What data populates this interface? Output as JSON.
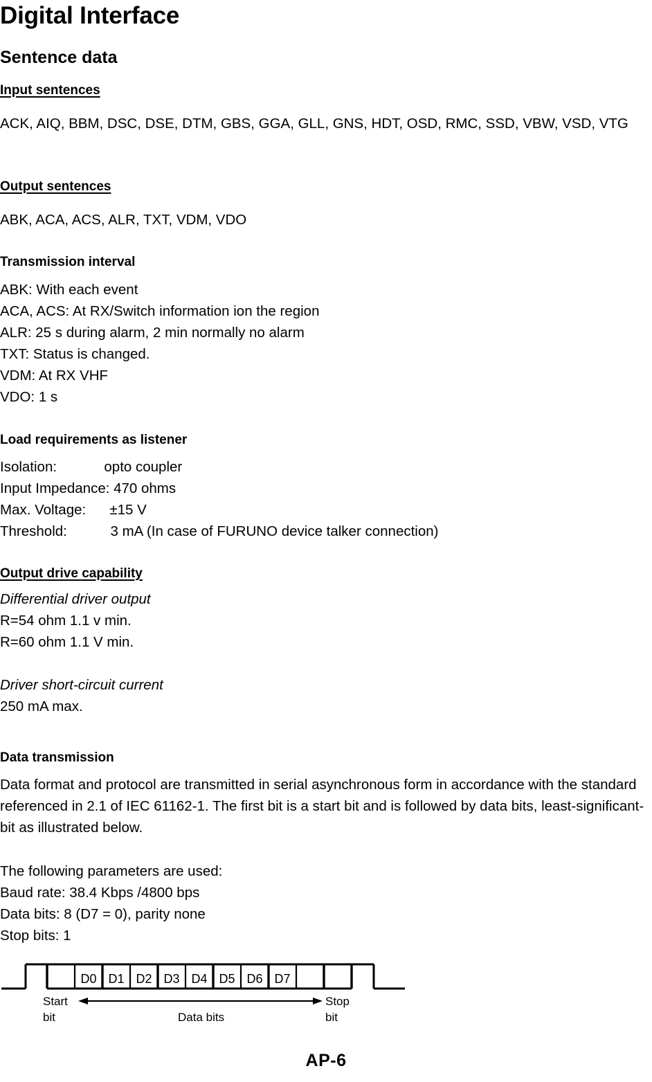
{
  "document": {
    "title": "Digital Interface",
    "page_label": "AP-6"
  },
  "sections": {
    "sentence_data": {
      "heading": "Sentence data",
      "input_sentences": {
        "heading": "Input sentences",
        "body": "ACK, AIQ, BBM, DSC, DSE, DTM, GBS, GGA, GLL, GNS, HDT, OSD, RMC, SSD, VBW, VSD, VTG"
      },
      "output_sentences": {
        "heading": "Output sentences",
        "body": "ABK, ACA, ACS, ALR, TXT, VDM, VDO"
      }
    },
    "transmission_interval": {
      "heading": "Transmission interval",
      "lines": [
        "ABK: With each event",
        "ACA, ACS: At RX/Switch information ion the region",
        "ALR: 25 s during alarm, 2 min normally no alarm",
        "TXT: Status is changed.",
        "VDM: At RX VHF",
        "VDO: 1 s"
      ]
    },
    "load_requirements": {
      "heading": "Load requirements as listener",
      "lines": [
        "Isolation:            opto coupler",
        "Input Impedance: 470 ohms",
        "Max. Voltage:      ±15 V",
        "Threshold:           3 mA (In case of FURUNO device talker connection)"
      ]
    },
    "output_drive": {
      "heading": "Output drive capability",
      "differential_label": "Differential driver output",
      "differential_lines": [
        "R=54 ohm 1.1 v min.",
        "R=60 ohm 1.1 V min."
      ],
      "short_circuit_label": "Driver short-circuit current",
      "short_circuit_lines": [
        "250 mA max."
      ]
    },
    "data_transmission": {
      "heading": "Data transmission",
      "body": "Data format and protocol are transmitted in serial asynchronous form in accordance with the standard referenced in 2.1 of IEC 61162-1. The first bit is a start bit and is followed by data bits, least-significant-bit as illustrated below.",
      "parameters_intro": "The following parameters are used:",
      "parameters": [
        "Baud rate: 38.4 Kbps /4800 bps",
        "Data bits: 8 (D7 = 0), parity none",
        "Stop bits: 1"
      ]
    }
  },
  "figure": {
    "bit_cells": [
      "",
      "D0",
      "D1",
      "D2",
      "D3",
      "D4",
      "D5",
      "D6",
      "D7",
      "",
      ""
    ],
    "start_label_line1": "Start",
    "start_label_line2": "bit",
    "data_label": "Data bits",
    "stop_label_line1": "Stop",
    "stop_label_line2": "bit"
  }
}
